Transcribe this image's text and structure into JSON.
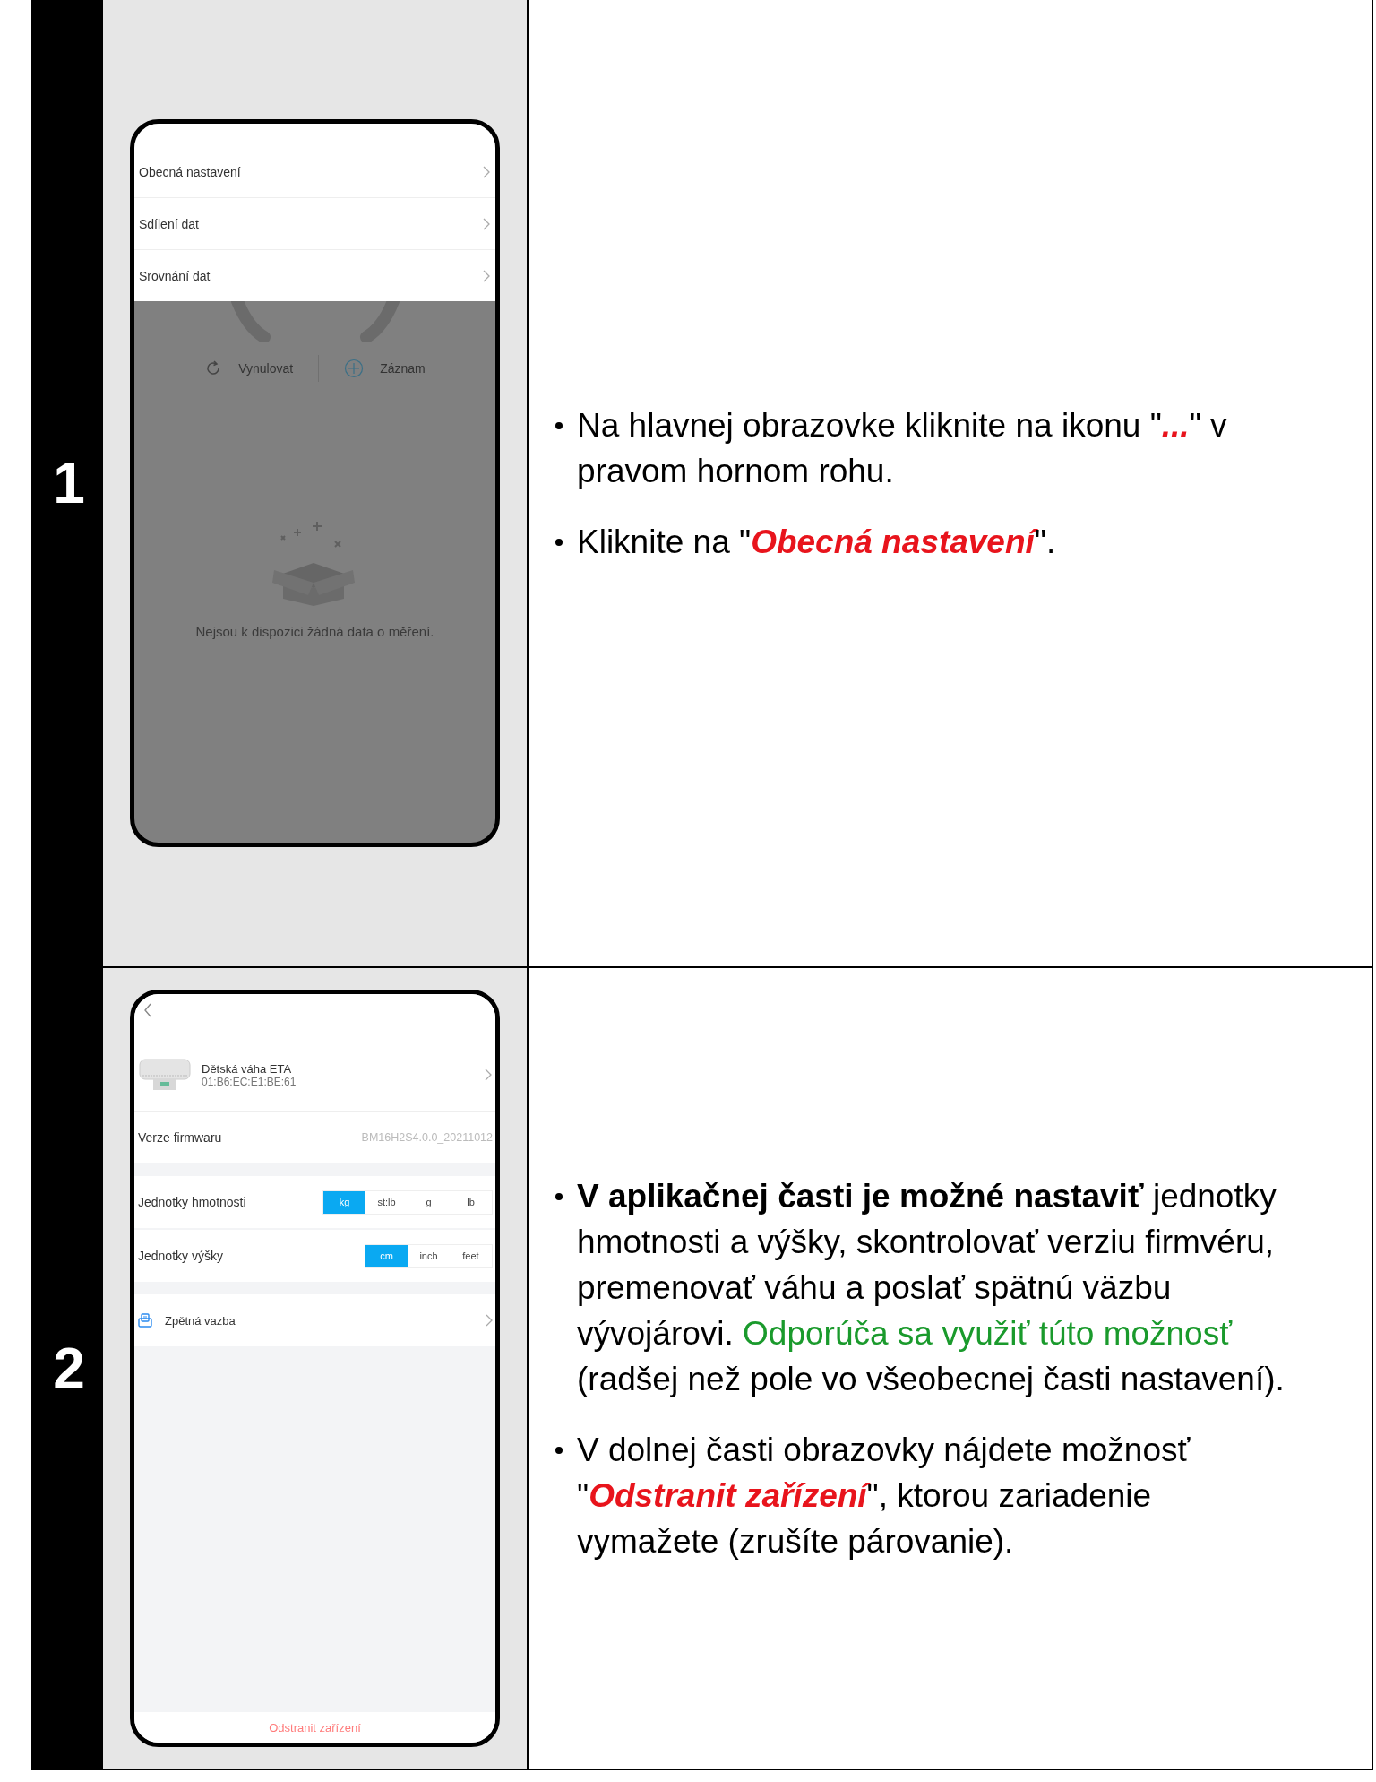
{
  "steps": [
    {
      "number": "1",
      "phone": {
        "kind": "menu",
        "menu_items": [
          "Obecná nastavení",
          "Sdílení dat",
          "Srovnání dat"
        ],
        "actions": [
          "Vynulovat",
          "Záznam"
        ],
        "empty_message": "Nejsou k dispozici žádná data o měření."
      },
      "bullets": [
        {
          "parts": [
            {
              "kind": "plain",
              "text": "Na hlavnej obrazovke kliknite na ikonu \""
            },
            {
              "kind": "highlight",
              "text": "..."
            },
            {
              "kind": "plain",
              "text": "\" v pravom hornom rohu."
            }
          ]
        },
        {
          "parts": [
            {
              "kind": "plain",
              "text": "Kliknite na \""
            },
            {
              "kind": "highlight",
              "text": "Obecná nastavení"
            },
            {
              "kind": "plain",
              "text": "\"."
            }
          ]
        }
      ]
    },
    {
      "number": "2",
      "phone": {
        "kind": "settings",
        "device_name": "Dětská váha ETA",
        "device_address": "01:B6:EC:E1:BE:61",
        "firmware_label": "Verze firmwaru",
        "firmware_value": "BM16H2S4.0.0_20211012",
        "unit_rows": [
          {
            "label": "Jednotky hmotnosti",
            "options": [
              {
                "label": "kg",
                "selected": true
              },
              {
                "label": "st:lb",
                "selected": false
              },
              {
                "label": "g",
                "selected": false
              },
              {
                "label": "lb",
                "selected": false
              }
            ]
          },
          {
            "label": "Jednotky výšky",
            "options": [
              {
                "label": "cm",
                "selected": true
              },
              {
                "label": "inch",
                "selected": false
              },
              {
                "label": "feet",
                "selected": false
              }
            ]
          }
        ],
        "feedback": "Zpětná vazba",
        "remove_button": "Odstranit zařízení"
      },
      "bullets": [
        {
          "parts": [
            {
              "kind": "strong",
              "text": "V aplikačnej časti je možné nastaviť"
            },
            {
              "kind": "plain",
              "text": " jednotky hmotnosti a výšky, skontrolovať verziu firmvéru, premenovať váhu a poslať spätnú väzbu vývojárovi. "
            },
            {
              "kind": "note",
              "text": "Odporúča sa využiť túto možnosť"
            },
            {
              "kind": "plain",
              "text": " (radšej než pole vo všeobecnej časti nastavení)."
            }
          ]
        },
        {
          "parts": [
            {
              "kind": "plain",
              "text": "V dolnej časti obrazovky nájdete možnosť \""
            },
            {
              "kind": "highlight",
              "text": "Odstranit zařízení"
            },
            {
              "kind": "plain",
              "text": "\", ktorou zariadenie vymažete (zrušíte párovanie)."
            }
          ]
        }
      ]
    }
  ]
}
